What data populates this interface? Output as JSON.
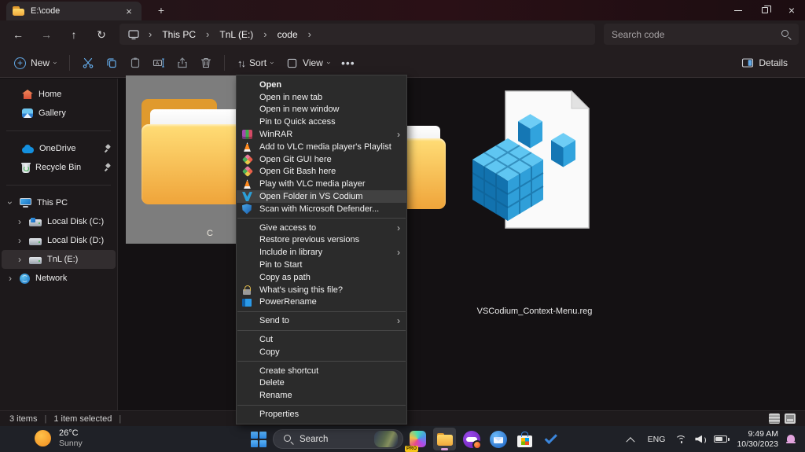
{
  "colors": {
    "accent_blue": "#5aa7e8",
    "folder_yellow": "#f5b73c",
    "menu_background": "#2b2b2b",
    "selection_gray": "#7d7d7d",
    "active_app_underline": "#d8a0d8"
  },
  "titlebar": {
    "tab_title": "E:\\code"
  },
  "navbar": {
    "breadcrumbs": [
      "This PC",
      "TnL (E:)",
      "code"
    ],
    "search_placeholder": "Search code"
  },
  "toolbar": {
    "new_label": "New",
    "sort_label": "Sort",
    "view_label": "View",
    "details_label": "Details"
  },
  "sidebar": {
    "items": [
      {
        "label": "Home",
        "icon": "home-icon",
        "level": "a"
      },
      {
        "label": "Gallery",
        "icon": "gallery-icon",
        "level": "a"
      },
      {
        "separator": true
      },
      {
        "label": "OneDrive",
        "icon": "onedrive-icon",
        "level": "a",
        "pinned": true
      },
      {
        "label": "Recycle Bin",
        "icon": "recycle-bin-icon",
        "level": "a",
        "pinned": true
      },
      {
        "separator": true
      },
      {
        "label": "This PC",
        "icon": "this-pc-icon",
        "level": "b",
        "chevron": "down"
      },
      {
        "label": "Local Disk (C:)",
        "icon": "drive-icon",
        "level": "c",
        "chevron": "right",
        "system": true
      },
      {
        "label": "Local Disk (D:)",
        "icon": "drive-icon",
        "level": "c",
        "chevron": "right"
      },
      {
        "label": "TnL (E:)",
        "icon": "drive-icon",
        "level": "c",
        "chevron": "right",
        "selected": true
      },
      {
        "label": "Network",
        "icon": "network-icon",
        "level": "b",
        "chevron": "right"
      }
    ]
  },
  "files": [
    {
      "name": "C",
      "type": "folder",
      "selected": true
    },
    {
      "name": "",
      "type": "folder"
    },
    {
      "name": "VSCodium_Context-Menu.reg",
      "type": "registry-file"
    }
  ],
  "context_menu": {
    "items": [
      {
        "label": "Open",
        "bold": true
      },
      {
        "label": "Open in new tab"
      },
      {
        "label": "Open in new window"
      },
      {
        "label": "Pin to Quick access"
      },
      {
        "label": "WinRAR",
        "icon": "winrar-icon",
        "submenu": true
      },
      {
        "label": "Add to VLC media player's Playlist",
        "icon": "vlc-icon"
      },
      {
        "label": "Open Git GUI here",
        "icon": "git-icon"
      },
      {
        "label": "Open Git Bash here",
        "icon": "git-icon"
      },
      {
        "label": "Play with VLC media player",
        "icon": "vlc-icon"
      },
      {
        "label": "Open Folder in VS Codium",
        "icon": "vscodium-icon",
        "highlighted": true
      },
      {
        "label": "Scan with Microsoft Defender...",
        "icon": "defender-icon",
        "separator_after": true
      },
      {
        "label": "Give access to",
        "submenu": true
      },
      {
        "label": "Restore previous versions"
      },
      {
        "label": "Include in library",
        "submenu": true
      },
      {
        "label": "Pin to Start"
      },
      {
        "label": "Copy as path"
      },
      {
        "label": "What's using this file?",
        "icon": "lock-icon"
      },
      {
        "label": "PowerRename",
        "icon": "powerrename-icon",
        "separator_after": true
      },
      {
        "label": "Send to",
        "submenu": true,
        "separator_after": true
      },
      {
        "label": "Cut"
      },
      {
        "label": "Copy",
        "separator_after": true
      },
      {
        "label": "Create shortcut"
      },
      {
        "label": "Delete"
      },
      {
        "label": "Rename",
        "separator_after": true
      },
      {
        "label": "Properties"
      }
    ]
  },
  "status_bar": {
    "item_count": "3 items",
    "selection": "1 item selected"
  },
  "taskbar": {
    "weather": {
      "temperature": "26°C",
      "condition": "Sunny"
    },
    "search_label": "Search",
    "apps": [
      {
        "icon": "creative-app-pro-icon",
        "badge": "PRO"
      },
      {
        "icon": "file-explorer-icon",
        "active": true
      },
      {
        "icon": "goggles-app-icon",
        "notification_dot": true
      },
      {
        "icon": "thunderbird-icon"
      },
      {
        "icon": "microsoft-store-icon"
      },
      {
        "icon": "todo-check-icon"
      }
    ],
    "tray": {
      "language": "ENG",
      "time": "9:49 AM",
      "date": "10/30/2023"
    }
  }
}
